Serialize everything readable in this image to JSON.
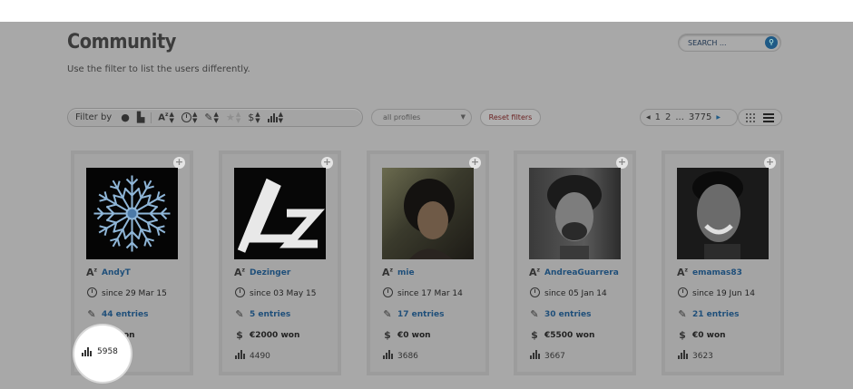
{
  "header": {
    "title": "Community",
    "subtitle": "Use the filter to list the users differently."
  },
  "search": {
    "placeholder": "SEARCH ..."
  },
  "filters": {
    "label": "Filter by",
    "profiles_value": "all profiles",
    "reset_label": "Reset filters"
  },
  "pagination": {
    "pages": [
      "1",
      "2",
      "...",
      "3775"
    ]
  },
  "users": [
    {
      "name": "AndyT",
      "since": "since 29 Mar 15",
      "entries": "44 entries",
      "won": "€0 won",
      "rank": "5958",
      "avatar": "snowflake"
    },
    {
      "name": "Dezinger",
      "since": "since 03 May 15",
      "entries": "5 entries",
      "won": "€2000 won",
      "rank": "4490",
      "avatar": "dz-logo"
    },
    {
      "name": "mie",
      "since": "since 17 Mar 14",
      "entries": "17 entries",
      "won": "€0 won",
      "rank": "3686",
      "avatar": "photo"
    },
    {
      "name": "AndreaGuarrera",
      "since": "since 05 Jan 14",
      "entries": "30 entries",
      "won": "€5500 won",
      "rank": "3667",
      "avatar": "photo"
    },
    {
      "name": "emamas83",
      "since": "since 19 Jun 14",
      "entries": "21 entries",
      "won": "€0 won",
      "rank": "3623",
      "avatar": "photo"
    }
  ],
  "colors": {
    "overlay": "#a8a8a8",
    "link": "#1f4f7a",
    "accent": "#1f5a86"
  }
}
